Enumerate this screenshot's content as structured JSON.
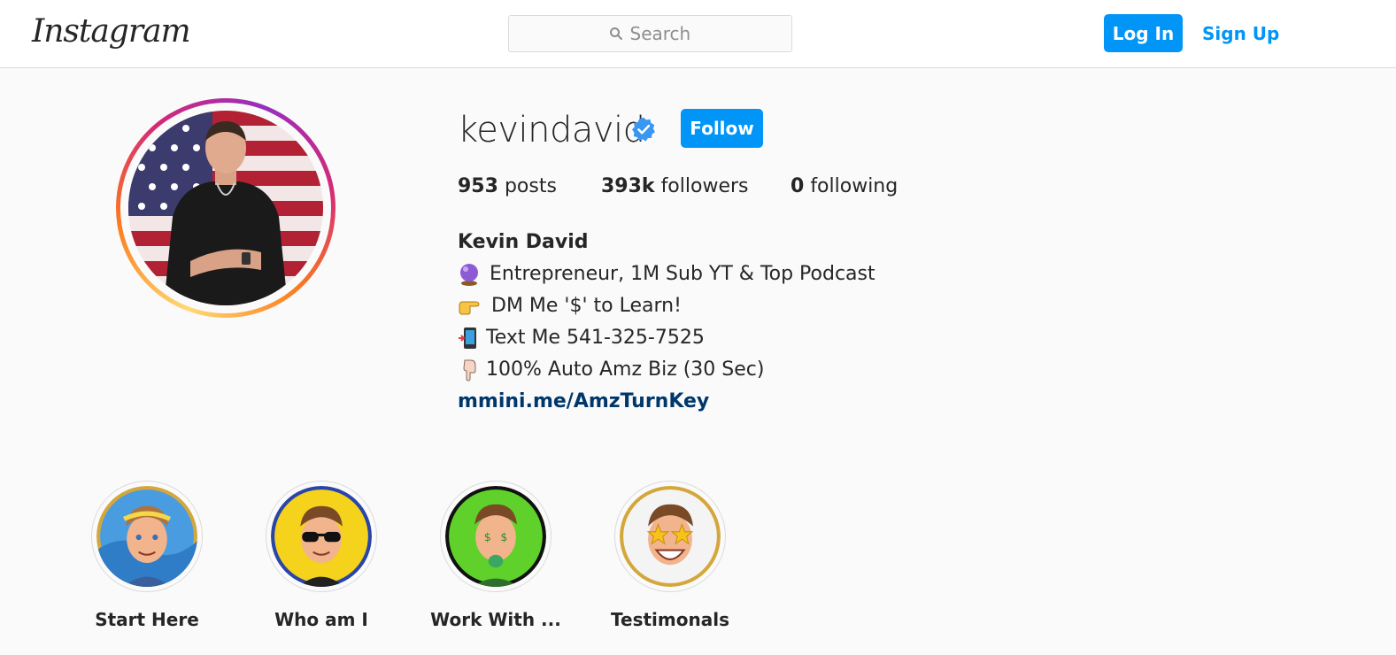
{
  "header": {
    "logo": "Instagram",
    "search_placeholder": "Search",
    "login_label": "Log In",
    "signup_label": "Sign Up"
  },
  "profile": {
    "username": "kevindavid",
    "verified": true,
    "follow_label": "Follow",
    "stats": {
      "posts_count": "953",
      "posts_label": "posts",
      "followers_count": "393k",
      "followers_label": "followers",
      "following_count": "0",
      "following_label": "following"
    },
    "bio": {
      "name": "Kevin David",
      "lines": [
        {
          "icon": "crystal-ball-icon",
          "text": "Entrepreneur, 1M Sub YT & Top Podcast"
        },
        {
          "icon": "pointing-right-icon",
          "text": "DM Me '$' to Learn!"
        },
        {
          "icon": "mobile-phone-icon",
          "text": "Text Me 541-325-7525"
        },
        {
          "icon": "pointing-down-icon",
          "text": "100% Auto Amz Biz (30 Sec)"
        }
      ],
      "link": "mmini.me/AmzTurnKey"
    }
  },
  "highlights": [
    {
      "label": "Start Here"
    },
    {
      "label": "Who am I"
    },
    {
      "label": "Work With ..."
    },
    {
      "label": "Testimonals"
    }
  ],
  "colors": {
    "accent": "#0095f6",
    "link": "#00376b",
    "text": "#262626",
    "muted": "#8e8e8e",
    "border": "#dbdbdb",
    "background": "#fafafa"
  }
}
